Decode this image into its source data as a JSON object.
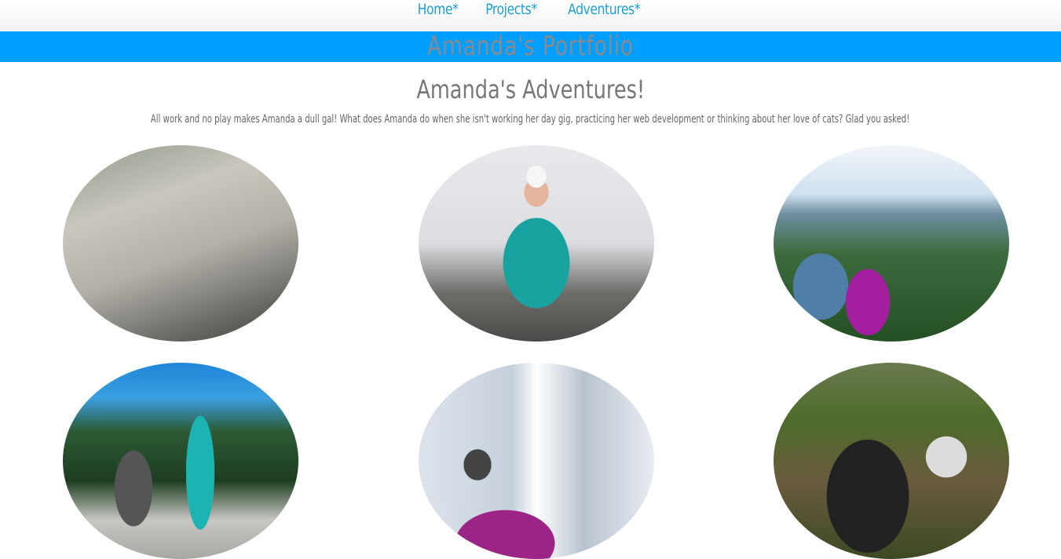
{
  "nav": {
    "links": [
      {
        "label": "Home*"
      },
      {
        "label": "Projects*"
      },
      {
        "label": "Adventures*"
      }
    ],
    "link_color": "#1a9fd9"
  },
  "banner": {
    "title": "Amanda's Portfolio",
    "background": "#009fff"
  },
  "main": {
    "heading": "Amanda's Adventures!",
    "intro": "All work and no play makes Amanda a dull gal! What does Amanda do when she isn't working her day gig, practicing her web development or thinking about her love of cats? Glad you asked!"
  },
  "gallery": {
    "photos": [
      {
        "subject": "rock-climbing-photo"
      },
      {
        "subject": "summit-portrait-photo"
      },
      {
        "subject": "forest-hike-photo"
      },
      {
        "subject": "alpine-lake-photo"
      },
      {
        "subject": "snow-bird-photo"
      },
      {
        "subject": "bouldering-photo"
      }
    ]
  }
}
